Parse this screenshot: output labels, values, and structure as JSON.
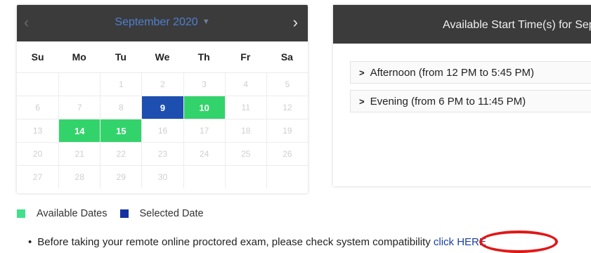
{
  "calendar": {
    "month_label": "September 2020",
    "prev_icon": "‹",
    "next_icon": "›",
    "weekdays": [
      "Su",
      "Mo",
      "Tu",
      "We",
      "Th",
      "Fr",
      "Sa"
    ],
    "days": [
      {
        "label": "",
        "state": "empty"
      },
      {
        "label": "",
        "state": "empty"
      },
      {
        "label": "1",
        "state": "disabled"
      },
      {
        "label": "2",
        "state": "disabled"
      },
      {
        "label": "3",
        "state": "disabled"
      },
      {
        "label": "4",
        "state": "disabled"
      },
      {
        "label": "5",
        "state": "disabled"
      },
      {
        "label": "6",
        "state": "disabled"
      },
      {
        "label": "7",
        "state": "disabled"
      },
      {
        "label": "8",
        "state": "disabled"
      },
      {
        "label": "9",
        "state": "selected"
      },
      {
        "label": "10",
        "state": "available"
      },
      {
        "label": "11",
        "state": "disabled"
      },
      {
        "label": "12",
        "state": "disabled"
      },
      {
        "label": "13",
        "state": "disabled"
      },
      {
        "label": "14",
        "state": "available"
      },
      {
        "label": "15",
        "state": "available"
      },
      {
        "label": "16",
        "state": "disabled"
      },
      {
        "label": "17",
        "state": "disabled"
      },
      {
        "label": "18",
        "state": "disabled"
      },
      {
        "label": "19",
        "state": "disabled"
      },
      {
        "label": "20",
        "state": "disabled"
      },
      {
        "label": "21",
        "state": "disabled"
      },
      {
        "label": "22",
        "state": "disabled"
      },
      {
        "label": "23",
        "state": "disabled"
      },
      {
        "label": "24",
        "state": "disabled"
      },
      {
        "label": "25",
        "state": "disabled"
      },
      {
        "label": "26",
        "state": "disabled"
      },
      {
        "label": "27",
        "state": "disabled"
      },
      {
        "label": "28",
        "state": "disabled"
      },
      {
        "label": "29",
        "state": "disabled"
      },
      {
        "label": "30",
        "state": "disabled"
      },
      {
        "label": "",
        "state": "empty"
      },
      {
        "label": "",
        "state": "empty"
      },
      {
        "label": "",
        "state": "empty"
      }
    ]
  },
  "legend": {
    "available_label": "Available Dates",
    "selected_label": "Selected Date",
    "available_color": "#42e08a",
    "selected_color": "#1530a0"
  },
  "time_panel": {
    "title": "Available Start Time(s) for Sep",
    "slots": [
      {
        "label": "Afternoon (from 12 PM to 5:45 PM)",
        "icon": "chevron-right-icon"
      },
      {
        "label": "Evening (from 6 PM to 11:45 PM)",
        "icon": "chevron-right-icon"
      }
    ]
  },
  "notice": {
    "text": "Before taking your remote online proctored exam, please check system compatibility",
    "link_text": "click HERE"
  },
  "colors": {
    "header_bg": "#3b3b3b",
    "available": "#33d36b",
    "selected": "#1d4fb0",
    "annotation_circle": "#e01818"
  }
}
